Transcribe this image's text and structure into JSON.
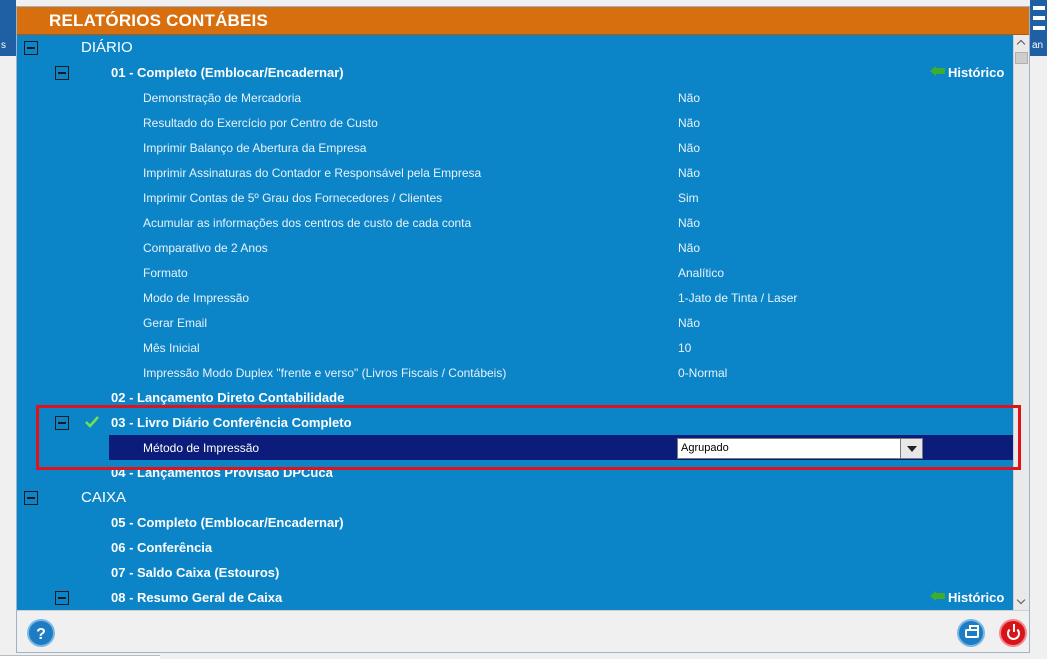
{
  "background_app": {
    "left_label": "s",
    "right_label": "an"
  },
  "dialog": {
    "title": "RELATÓRIOS CONTÁBEIS",
    "history_label": "Histórico",
    "colors": {
      "header": "#d86f0f",
      "tree_bg": "#0c85c8",
      "selected_row": "#0c1c7a",
      "highlight": "#e0131b"
    }
  },
  "diario": {
    "label": "DIÁRIO",
    "report_01": {
      "label": "01 - Completo (Emblocar/Encadernar)",
      "options": [
        {
          "name": "Demonstração de Mercadoria",
          "value": "Não"
        },
        {
          "name": "Resultado do Exercício por Centro de Custo",
          "value": "Não"
        },
        {
          "name": "Imprimir Balanço de Abertura da Empresa",
          "value": "Não"
        },
        {
          "name": "Imprimir Assinaturas do Contador e Responsável pela Empresa",
          "value": "Não"
        },
        {
          "name": "Imprimir Contas de 5º Grau dos Fornecedores / Clientes",
          "value": "Sim"
        },
        {
          "name": "Acumular as informações dos centros de custo de cada conta",
          "value": "Não"
        },
        {
          "name": "Comparativo de 2 Anos",
          "value": "Não"
        },
        {
          "name": "Formato",
          "value": "Analítico"
        },
        {
          "name": "Modo de Impressão",
          "value": "1-Jato de Tinta / Laser"
        },
        {
          "name": "Gerar Email",
          "value": "Não"
        },
        {
          "name": "Mês Inicial",
          "value": "10"
        },
        {
          "name": "Impressão Modo Duplex \"frente e verso\" (Livros Fiscais / Contábeis)",
          "value": "0-Normal"
        }
      ]
    },
    "report_02": {
      "label": "02 - Lançamento Direto Contabilidade"
    },
    "report_03": {
      "label": "03 - Livro Diário Conferência Completo",
      "option_name": "Método de Impressão",
      "option_value": "Agrupado"
    },
    "report_04": {
      "label": "04 - Lançamentos Provisão DPCuca"
    }
  },
  "caixa": {
    "label": "CAIXA",
    "reports": [
      "05 - Completo (Emblocar/Encadernar)",
      "06 - Conferência",
      "07 - Saldo Caixa (Estouros)",
      "08 - Resumo Geral de Caixa"
    ]
  },
  "footer": {
    "help_label": "?"
  },
  "icons": {
    "expander": "minus-box-icon",
    "history": "green-arrow-icon",
    "checked": "checkmark-icon",
    "help": "help-icon",
    "print": "printer-icon",
    "close": "power-icon"
  }
}
